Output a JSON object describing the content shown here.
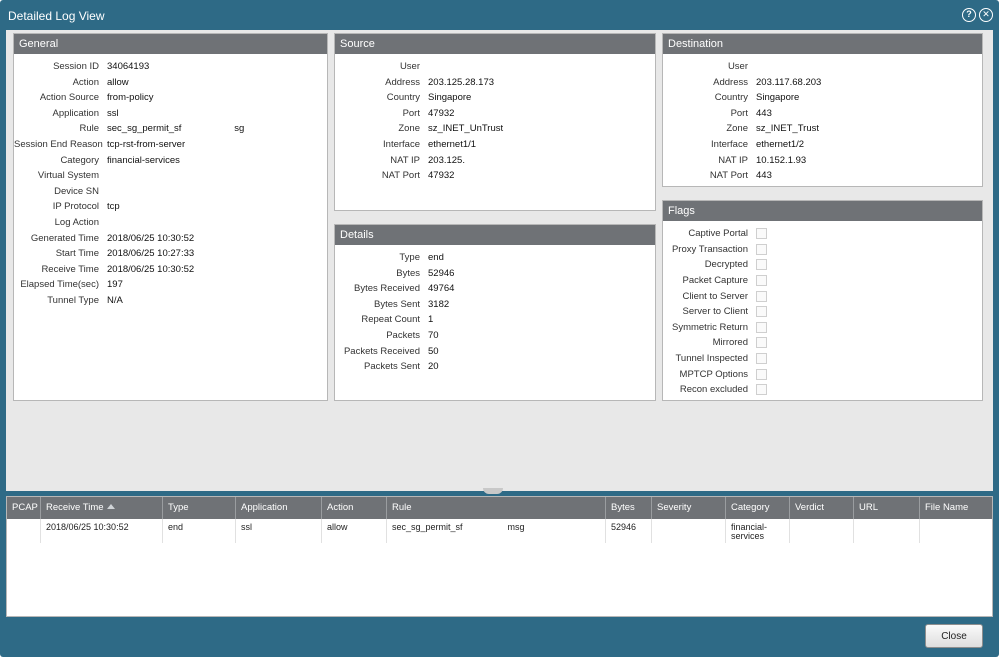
{
  "window": {
    "title": "Detailed Log View"
  },
  "general": {
    "header": "General",
    "rows": [
      {
        "label": "Session ID",
        "value": "34064193"
      },
      {
        "label": "Action",
        "value": "allow"
      },
      {
        "label": "Action Source",
        "value": "from-policy"
      },
      {
        "label": "Application",
        "value": "ssl"
      },
      {
        "label": "Rule",
        "value": "sec_sg_permit_sf                    sg"
      },
      {
        "label": "Session End Reason",
        "value": "tcp-rst-from-server"
      },
      {
        "label": "Category",
        "value": "financial-services"
      },
      {
        "label": "Virtual System",
        "value": ""
      },
      {
        "label": "Device SN",
        "value": ""
      },
      {
        "label": "IP Protocol",
        "value": "tcp"
      },
      {
        "label": "Log Action",
        "value": ""
      },
      {
        "label": "Generated Time",
        "value": "2018/06/25 10:30:52"
      },
      {
        "label": "Start Time",
        "value": "2018/06/25 10:27:33"
      },
      {
        "label": "Receive Time",
        "value": "2018/06/25 10:30:52"
      },
      {
        "label": "Elapsed Time(sec)",
        "value": "197"
      },
      {
        "label": "Tunnel Type",
        "value": "N/A"
      }
    ]
  },
  "source": {
    "header": "Source",
    "rows": [
      {
        "label": "User",
        "value": ""
      },
      {
        "label": "Address",
        "value": "203.125.28.173"
      },
      {
        "label": "Country",
        "value": "Singapore"
      },
      {
        "label": "Port",
        "value": "47932"
      },
      {
        "label": "Zone",
        "value": "sz_INET_UnTrust"
      },
      {
        "label": "Interface",
        "value": "ethernet1/1"
      },
      {
        "label": "NAT IP",
        "value": "203.125."
      },
      {
        "label": "NAT Port",
        "value": "47932"
      }
    ]
  },
  "destination": {
    "header": "Destination",
    "rows": [
      {
        "label": "User",
        "value": ""
      },
      {
        "label": "Address",
        "value": "203.117.68.203"
      },
      {
        "label": "Country",
        "value": "Singapore"
      },
      {
        "label": "Port",
        "value": "443"
      },
      {
        "label": "Zone",
        "value": "sz_INET_Trust"
      },
      {
        "label": "Interface",
        "value": "ethernet1/2"
      },
      {
        "label": "NAT IP",
        "value": "10.152.1.93"
      },
      {
        "label": "NAT Port",
        "value": "443"
      }
    ]
  },
  "details": {
    "header": "Details",
    "rows": [
      {
        "label": "Type",
        "value": "end"
      },
      {
        "label": "Bytes",
        "value": "52946"
      },
      {
        "label": "Bytes Received",
        "value": "49764"
      },
      {
        "label": "Bytes Sent",
        "value": "3182"
      },
      {
        "label": "Repeat Count",
        "value": "1"
      },
      {
        "label": "Packets",
        "value": "70"
      },
      {
        "label": "Packets Received",
        "value": "50"
      },
      {
        "label": "Packets Sent",
        "value": "20"
      }
    ]
  },
  "flags": {
    "header": "Flags",
    "items": [
      "Captive Portal",
      "Proxy Transaction",
      "Decrypted",
      "Packet Capture",
      "Client to Server",
      "Server to Client",
      "Symmetric Return",
      "Mirrored",
      "Tunnel Inspected",
      "MPTCP Options",
      "Recon excluded"
    ]
  },
  "log_table": {
    "columns": [
      "PCAP",
      "Receive Time",
      "Type",
      "Application",
      "Action",
      "Rule",
      "Bytes",
      "Severity",
      "Category",
      "Verdict",
      "URL",
      "File Name"
    ],
    "row": {
      "pcap": "",
      "receive_time": "2018/06/25 10:30:52",
      "type": "end",
      "application": "ssl",
      "action": "allow",
      "rule": "sec_sg_permit_sf                  msg",
      "bytes": "52946",
      "severity": "",
      "category": "financial-services",
      "verdict": "",
      "url": "",
      "file_name": ""
    }
  },
  "footer": {
    "close_label": "Close"
  },
  "icons": {
    "help": "help-icon",
    "close": "close-icon"
  }
}
